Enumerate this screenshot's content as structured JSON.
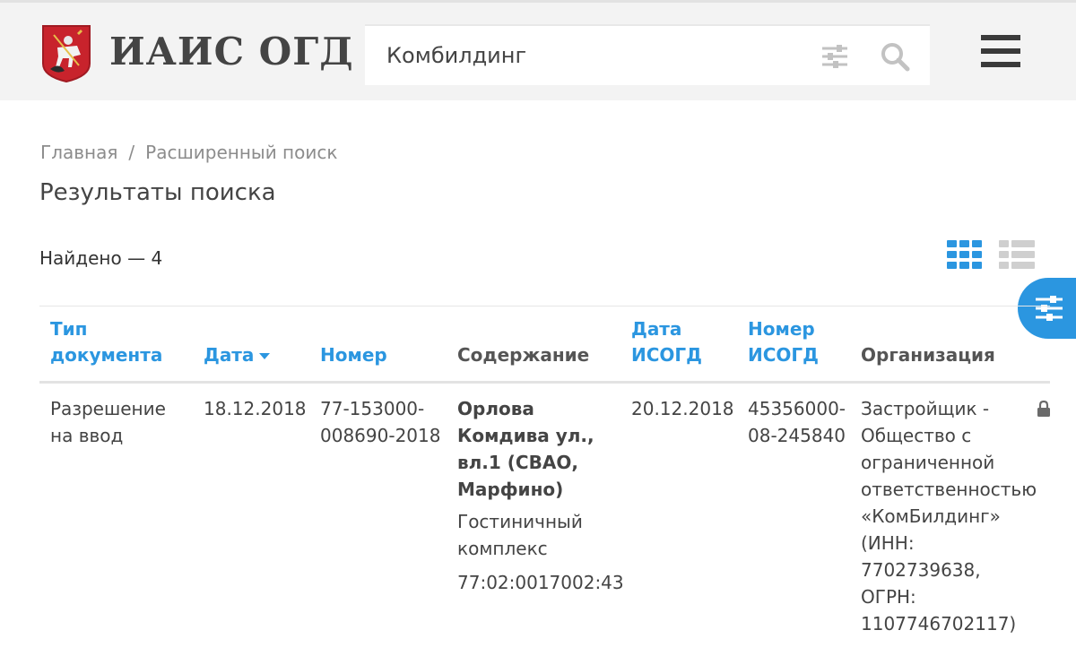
{
  "header": {
    "logo_text": "ИАИС ОГД",
    "search_value": "Комбилдинг"
  },
  "breadcrumb": {
    "home": "Главная",
    "separator": "/",
    "current": "Расширенный поиск"
  },
  "page_title": "Результаты поиска",
  "results": {
    "found_label": "Найдено — 4"
  },
  "colors": {
    "accent": "#2b96e0",
    "header_bg": "#f3f3f3",
    "text": "#444444"
  },
  "table": {
    "columns": {
      "doc_type_1": "Тип",
      "doc_type_2": "документа",
      "date": "Дата",
      "number": "Номер",
      "content": "Содержание",
      "isogd_date_1": "Дата",
      "isogd_date_2": "ИСОГД",
      "isogd_number_1": "Номер",
      "isogd_number_2": "ИСОГД",
      "organization": "Организация"
    },
    "rows": [
      {
        "doc_type_1": "Разрешение",
        "doc_type_2": "на ввод",
        "date": "18.12.2018",
        "number_1": "77-153000-",
        "number_2": "008690-2018",
        "address_1": "Орлова",
        "address_2": "Комдива ул.,",
        "address_3": "вл.1 (СВАО,",
        "address_4": "Марфино)",
        "object_1": "Гостиничный",
        "object_2": "комплекс",
        "cadastral": "77:02:0017002:43",
        "isogd_date": "20.12.2018",
        "isogd_number_1": "45356000-",
        "isogd_number_2": "08-245840",
        "org_1": "Застройщик -",
        "org_2": "Общество с",
        "org_3": "ограниченной",
        "org_4": "ответственностью",
        "org_5": "«КомБилдинг»",
        "org_6": "(ИНН:",
        "org_7": "7702739638,",
        "org_8": "ОГРН:",
        "org_9": "1107746702117)"
      }
    ]
  }
}
